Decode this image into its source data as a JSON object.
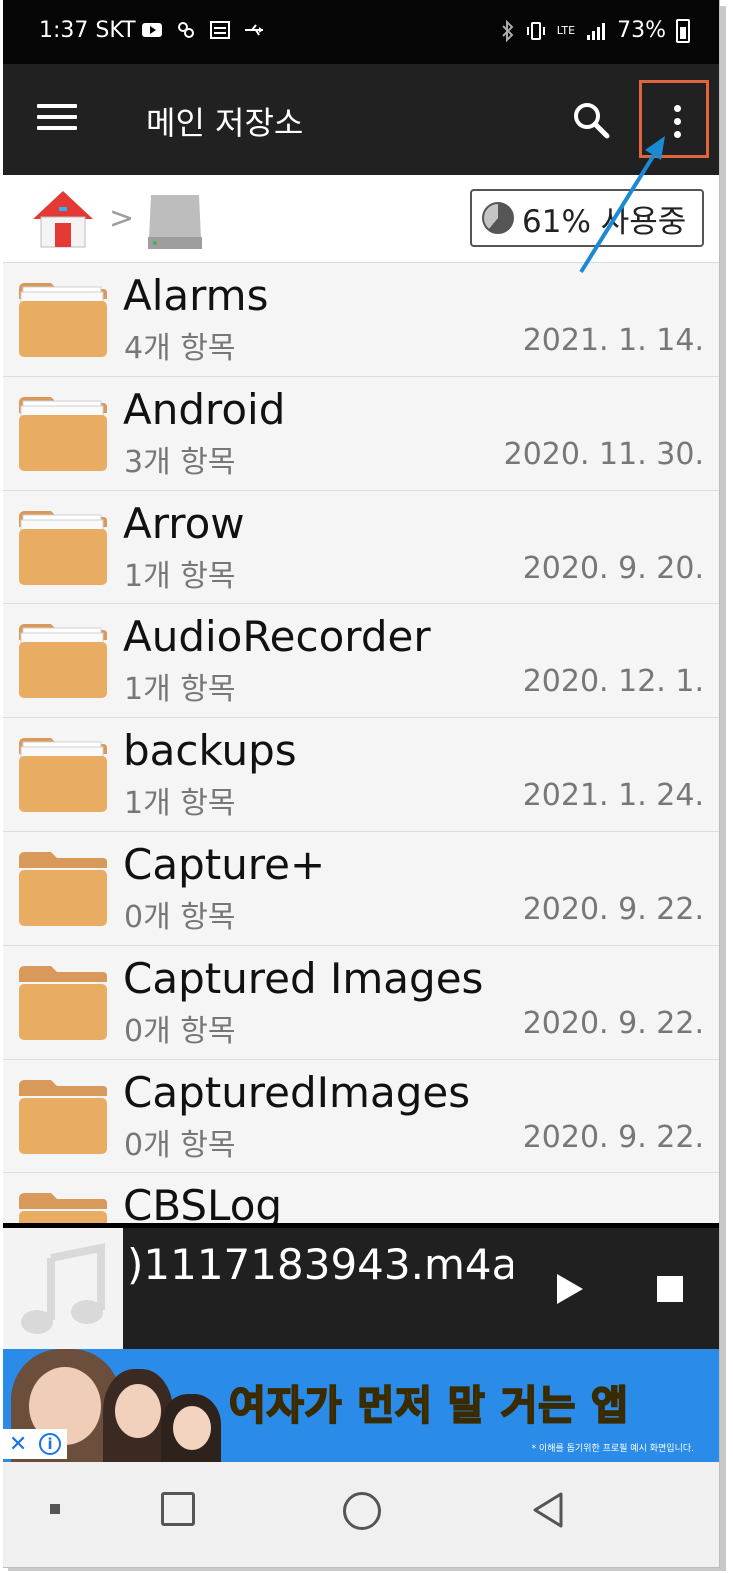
{
  "status_bar": {
    "time": "1:37",
    "carrier": "SKT",
    "battery": "73%",
    "network": "LTE"
  },
  "toolbar": {
    "title": "메인 저장소"
  },
  "breadcrumb": {
    "separator": ">",
    "usage_label": "61% 사용중",
    "usage_fraction": 0.61
  },
  "folders": [
    {
      "name": "Alarms",
      "count": "4개 항목",
      "date": "2021. 1. 14."
    },
    {
      "name": "Android",
      "count": "3개 항목",
      "date": "2020. 11. 30."
    },
    {
      "name": "Arrow",
      "count": "1개 항목",
      "date": "2020. 9. 20."
    },
    {
      "name": "AudioRecorder",
      "count": "1개 항목",
      "date": "2020. 12. 1."
    },
    {
      "name": "backups",
      "count": "1개 항목",
      "date": "2021. 1. 24."
    },
    {
      "name": "Capture+",
      "count": "0개 항목",
      "date": "2020. 9. 22."
    },
    {
      "name": "Captured Images",
      "count": "0개 항목",
      "date": "2020. 9. 22."
    },
    {
      "name": "CapturedImages",
      "count": "0개 항목",
      "date": "2020. 9. 22."
    },
    {
      "name": "CBSLog",
      "count": "",
      "date": ""
    }
  ],
  "player": {
    "track": ")1117183943.m4a"
  },
  "ad": {
    "headline": "여자가 먼저 말 거는 앱",
    "note": "* 이해를 돕기위한 프로필 예시 화면입니다.",
    "close": "✕",
    "info": "i"
  },
  "colors": {
    "toolbar": "#212121",
    "highlight": "#e0653f",
    "folder": "#e8ad62",
    "arrow": "#1a8ad4"
  }
}
